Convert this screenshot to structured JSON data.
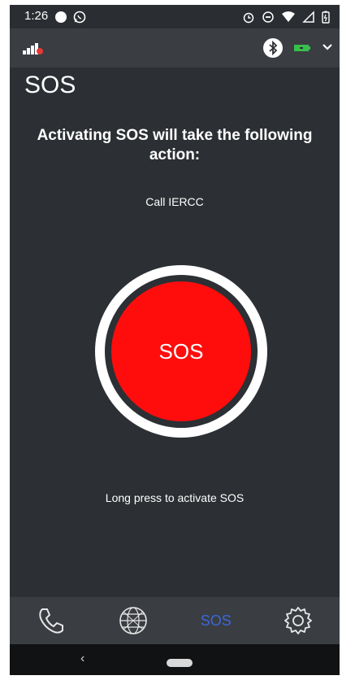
{
  "status_bar": {
    "time": "1:26",
    "icons": [
      "white-circle-icon",
      "whatsapp-icon",
      "alarm-icon",
      "do-not-disturb-icon",
      "wifi-icon",
      "cell-signal-icon",
      "battery-icon"
    ]
  },
  "toolbar": {
    "icons": [
      "signal-bars-icon",
      "bluetooth-icon",
      "device-battery-icon",
      "chevron-down-icon"
    ],
    "battery_color": "#36c14a"
  },
  "page": {
    "title": "SOS",
    "headline": "Activating SOS will take the following action:",
    "action": "Call IERCC",
    "sos_button_label": "SOS",
    "hint": "Long press to activate SOS"
  },
  "bottom_nav": {
    "items": [
      {
        "icon": "phone-icon"
      },
      {
        "icon": "globe-icon"
      },
      {
        "label": "SOS",
        "active": true
      },
      {
        "icon": "settings-gear-icon"
      }
    ]
  },
  "system_nav": {
    "back_symbol": "‹"
  },
  "colors": {
    "background": "#2c2f33",
    "bar": "#3a3d42",
    "sos_red": "#ff0d0d",
    "active_nav": "#3a68d8"
  }
}
